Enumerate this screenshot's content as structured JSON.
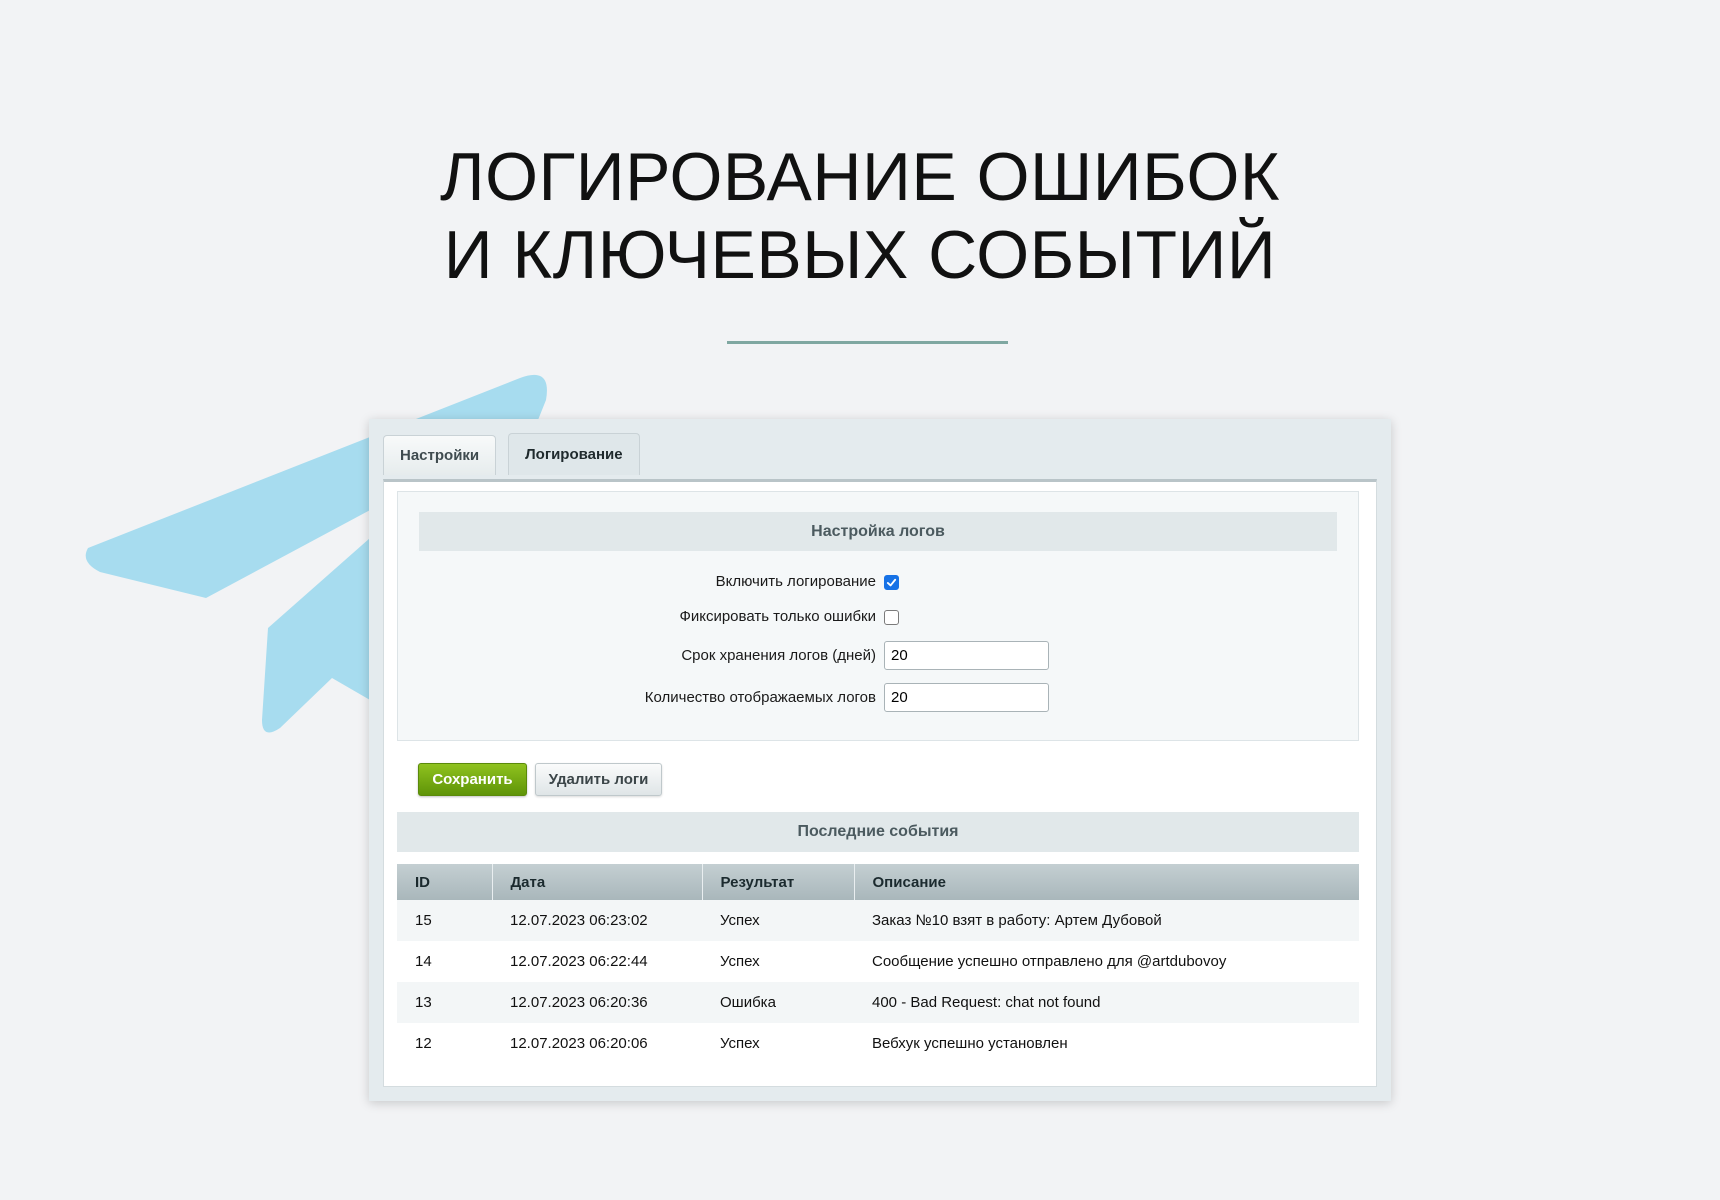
{
  "headline": {
    "line1": "ЛОГИРОВАНИЕ ОШИБОК",
    "line2": "И КЛЮЧЕВЫХ СОБЫТИЙ"
  },
  "colors": {
    "accent_rule": "#7fa7a1",
    "plane": "#a7dcef",
    "save_button": "#7bb016",
    "checkbox_checked": "#1672e6"
  },
  "tabs": [
    {
      "label": "Настройки",
      "active": false
    },
    {
      "label": "Логирование",
      "active": true
    }
  ],
  "settings": {
    "section_title": "Настройка логов",
    "enable_logging": {
      "label": "Включить логирование",
      "checked": true
    },
    "errors_only": {
      "label": "Фиксировать только ошибки",
      "checked": false
    },
    "retention_days": {
      "label": "Срок хранения логов (дней)",
      "value": "20"
    },
    "display_count": {
      "label": "Количество отображаемых логов",
      "value": "20"
    }
  },
  "actions": {
    "save_label": "Сохранить",
    "delete_label": "Удалить логи"
  },
  "events": {
    "section_title": "Последние события",
    "columns": [
      "ID",
      "Дата",
      "Результат",
      "Описание"
    ],
    "rows": [
      [
        "15",
        "12.07.2023 06:23:02",
        "Успех",
        "Заказ №10 взят в работу: Артем Дубовой"
      ],
      [
        "14",
        "12.07.2023 06:22:44",
        "Успех",
        "Сообщение успешно отправлено для @artdubovoy"
      ],
      [
        "13",
        "12.07.2023 06:20:36",
        "Ошибка",
        "400 - Bad Request: chat not found"
      ],
      [
        "12",
        "12.07.2023 06:20:06",
        "Успех",
        "Вебхук успешно установлен"
      ]
    ]
  }
}
